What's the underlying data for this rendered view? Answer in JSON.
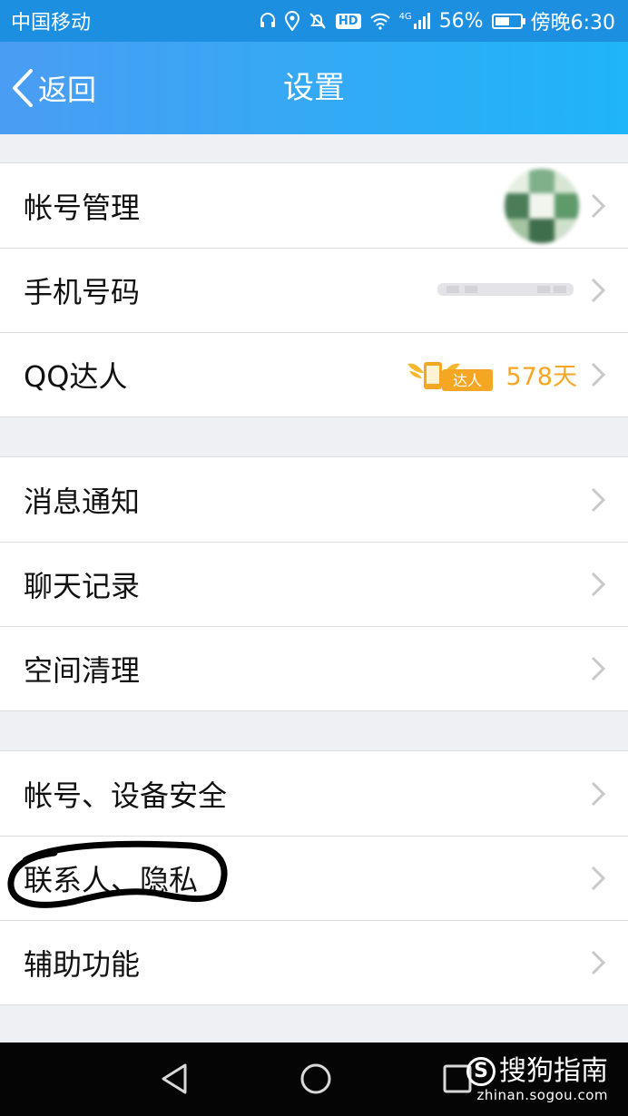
{
  "status_bar": {
    "carrier": "中国移动",
    "network": "4G",
    "battery": "56%",
    "battery_level": 0.56,
    "time": "傍晚6:30",
    "hd": "HD",
    "icons": [
      "headset-icon",
      "location-icon",
      "mute-icon",
      "hd-icon",
      "wifi-icon",
      "signal-icon",
      "battery-icon"
    ]
  },
  "header": {
    "back_label": "返回",
    "title": "设置"
  },
  "groups": [
    {
      "items": [
        {
          "label": "帐号管理"
        },
        {
          "label": "手机号码"
        },
        {
          "label": "QQ达人",
          "badge": "达人",
          "days": "578天"
        }
      ]
    },
    {
      "items": [
        {
          "label": "消息通知"
        },
        {
          "label": "聊天记录"
        },
        {
          "label": "空间清理"
        }
      ]
    },
    {
      "items": [
        {
          "label": "帐号、设备安全"
        },
        {
          "label": "联系人、隐私"
        },
        {
          "label": "辅助功能"
        }
      ]
    }
  ],
  "nav_bar": {
    "icons": [
      "back-triangle-icon",
      "home-circle-icon",
      "recents-square-icon"
    ]
  },
  "watermark": {
    "name": "搜狗指南",
    "logo": "S",
    "url": "zhinan.sogou.com"
  },
  "colors": {
    "title_gradient_start": "#4a9df3",
    "title_gradient_end": "#1fb5f6",
    "accent_orange": "#f5a623",
    "annotation": "#000000"
  }
}
